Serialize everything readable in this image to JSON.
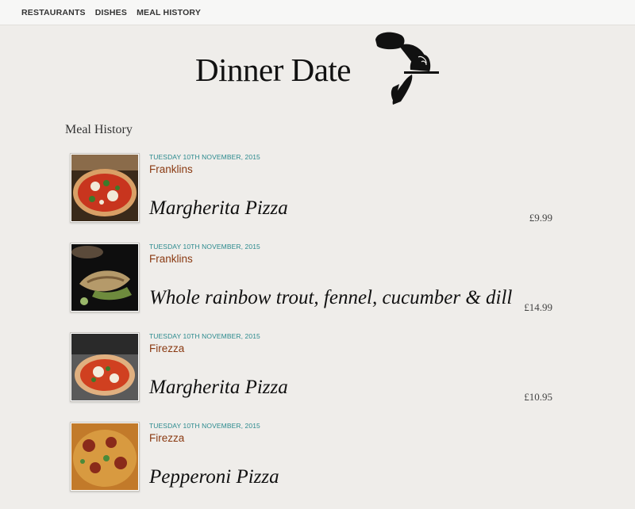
{
  "nav": {
    "items": [
      "RESTAURANTS",
      "DISHES",
      "MEAL HISTORY"
    ]
  },
  "brand": {
    "title": "Dinner Date",
    "logo_icon": "waiter-cloche-icon"
  },
  "section": {
    "title": "Meal History"
  },
  "meals": [
    {
      "date": "TUESDAY 10TH NOVEMBER, 2015",
      "restaurant": "Franklins",
      "dish": "Margherita Pizza",
      "price": "£9.99",
      "image_icon": "pizza-photo"
    },
    {
      "date": "TUESDAY 10TH NOVEMBER, 2015",
      "restaurant": "Franklins",
      "dish": "Whole rainbow trout, fennel, cucumber & dill",
      "price": "£14.99",
      "image_icon": "trout-photo"
    },
    {
      "date": "TUESDAY 10TH NOVEMBER, 2015",
      "restaurant": "Firezza",
      "dish": "Margherita Pizza",
      "price": "£10.95",
      "image_icon": "pizza-photo"
    },
    {
      "date": "TUESDAY 10TH NOVEMBER, 2015",
      "restaurant": "Firezza",
      "dish": "Pepperoni Pizza",
      "price": "",
      "image_icon": "pizza-photo"
    }
  ],
  "colors": {
    "background": "#efedea",
    "date_teal": "#2b8a8e",
    "restaurant_brown": "#8a3a12"
  }
}
